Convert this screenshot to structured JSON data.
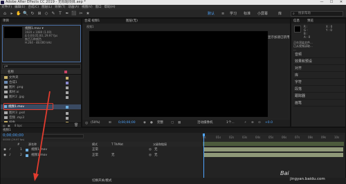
{
  "titlebar": {
    "title": "Adobe After Effects CC 2019 - 无标题项目.aep *",
    "minimize": "—",
    "maximize": "☐",
    "close": "✕"
  },
  "menu": [
    "文件(F)",
    "编辑(E)",
    "合成(C)",
    "图层(L)",
    "效果(T)",
    "动画(A)",
    "视图(V)",
    "窗口",
    "帮助(H)"
  ],
  "toolbar": {
    "tools": [
      "⌂",
      "▸",
      "✋",
      "🔍",
      "↻",
      "⊞",
      "◇",
      "✎",
      "T",
      "✒",
      "⬛",
      "✂",
      "★"
    ],
    "workspaces": [
      "默认",
      "≡",
      "学习",
      "标准",
      "小屏幕",
      "库"
    ],
    "active_workspace": "默认",
    "search_placeholder": "搜索帮助"
  },
  "project": {
    "tab": "项目",
    "preview": {
      "name": "视频1.mov ▾",
      "line1": "1920 x 1080 (1.00)",
      "line2": "Δ 0;00;05;00, 29.97 fps",
      "line3": "数百万种颜色",
      "line4": "H.264 - 48.000 kHz"
    },
    "search_placeholder": "ρ▾",
    "col_name": "名称",
    "items": [
      {
        "name": "文件夹",
        "type": "folder"
      },
      {
        "name": "合成1",
        "type": "comp"
      },
      {
        "name": "图片 .png",
        "type": "img"
      },
      {
        "name": "素材 ai",
        "type": "img"
      },
      {
        "name": "图片2 .jpg",
        "type": "img"
      },
      {
        "name": "视频1.mov",
        "type": "video"
      },
      {
        "name": "图片3 .psd",
        "type": "img"
      },
      {
        "name": "音频 .mp3",
        "type": "img"
      },
      {
        "name": "纯色",
        "type": "folder"
      }
    ],
    "footer": "8 bpc"
  },
  "composition": {
    "tab": "合成 视频1",
    "sub_tab": "图层(无)",
    "zoom": "(50%)",
    "time": "0;00;00;00",
    "quality": "完整",
    "camera": "活动摄像机",
    "views": "1个...",
    "exposure": "+0.0"
  },
  "right_panel": {
    "info_tab": "信息",
    "preview_tab": "预览",
    "values": [
      "R :",
      "G :",
      "B :",
      "A : 0",
      "X : 0",
      "Y : 0"
    ],
    "info_lines": [
      "正在渲染文件...",
      "已从视频读取...",
      "..."
    ],
    "items": [
      "音频",
      "效果和预设",
      "对齐",
      "库",
      "字符",
      "段落",
      "跟踪器",
      "画笔"
    ],
    "label_right": "显示加速已禁用"
  },
  "timeline": {
    "tab": "视频1",
    "time": "0;00;00;00",
    "fps": "00000 (29.97 fps)",
    "columns": [
      "#",
      "源名称",
      "模式",
      "T TrkMat",
      "父级和链接"
    ],
    "layers": [
      {
        "num": "1",
        "name": "视频1.mov",
        "mode": "正常",
        "trk": "",
        "parent": "无"
      },
      {
        "num": "2",
        "name": "视频1.mov",
        "mode": "正常",
        "trk": "无",
        "parent": "无"
      }
    ],
    "ruler": [
      "0s",
      "01s",
      "02s",
      "03s",
      "04s",
      "05s",
      "06s",
      "07s",
      "08s",
      "09s",
      "10s"
    ],
    "footer": "切换开关/模式"
  },
  "watermark": "jingyan.baidu.com",
  "colors": {
    "highlight": "#e23c2f",
    "accent": "#4ea5ff",
    "layer_bar": "#8f9878"
  }
}
